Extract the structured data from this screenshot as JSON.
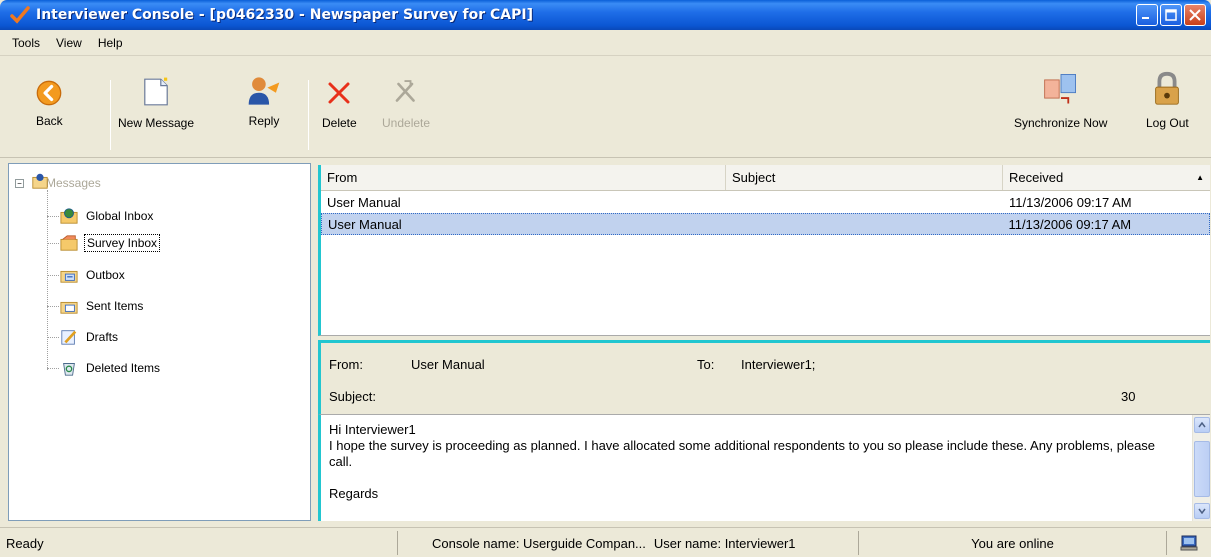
{
  "window": {
    "title": "Interviewer Console - [p0462330 - Newspaper Survey for CAPI]",
    "accent": "#0b56d3"
  },
  "menu": [
    "Tools",
    "View",
    "Help"
  ],
  "toolbar": {
    "back": "Back",
    "new_message": "New Message",
    "reply": "Reply",
    "delete": "Delete",
    "undelete": "Undelete",
    "synchronize": "Synchronize Now",
    "logout": "Log Out"
  },
  "tree": {
    "root": "Messages",
    "items": [
      {
        "label": "Global Inbox",
        "icon": "globe-folder-icon"
      },
      {
        "label": "Survey Inbox",
        "icon": "survey-folder-icon",
        "selected": true
      },
      {
        "label": "Outbox",
        "icon": "outbox-icon"
      },
      {
        "label": "Sent Items",
        "icon": "sent-items-icon"
      },
      {
        "label": "Drafts",
        "icon": "drafts-icon"
      },
      {
        "label": "Deleted Items",
        "icon": "recycle-bin-icon"
      }
    ]
  },
  "list": {
    "columns": {
      "from": "From",
      "subject": "Subject",
      "received": "Received",
      "sort_indicator": "▲"
    },
    "rows": [
      {
        "from": "User Manual",
        "subject": "",
        "received": "11/13/2006 09:17 AM",
        "selected": false
      },
      {
        "from": "User Manual",
        "subject": "",
        "received": "11/13/2006 09:17 AM",
        "selected": true
      }
    ]
  },
  "preview": {
    "from_label": "From:",
    "from_value": "User Manual",
    "to_label": "To:",
    "to_value": "Interviewer1;",
    "subject_label": "Subject:",
    "subject_value": "",
    "number": "30"
  },
  "body": {
    "lines": [
      "Hi Interviewer1",
      "I hope the survey is proceeding as planned. I have allocated some additional respondents to you so please include these. Any problems, please call.",
      "",
      "Regards"
    ]
  },
  "status": {
    "ready": "Ready",
    "console": "Console name:  Userguide Compan...",
    "user": "User name: Interviewer1",
    "online": "You are online"
  }
}
